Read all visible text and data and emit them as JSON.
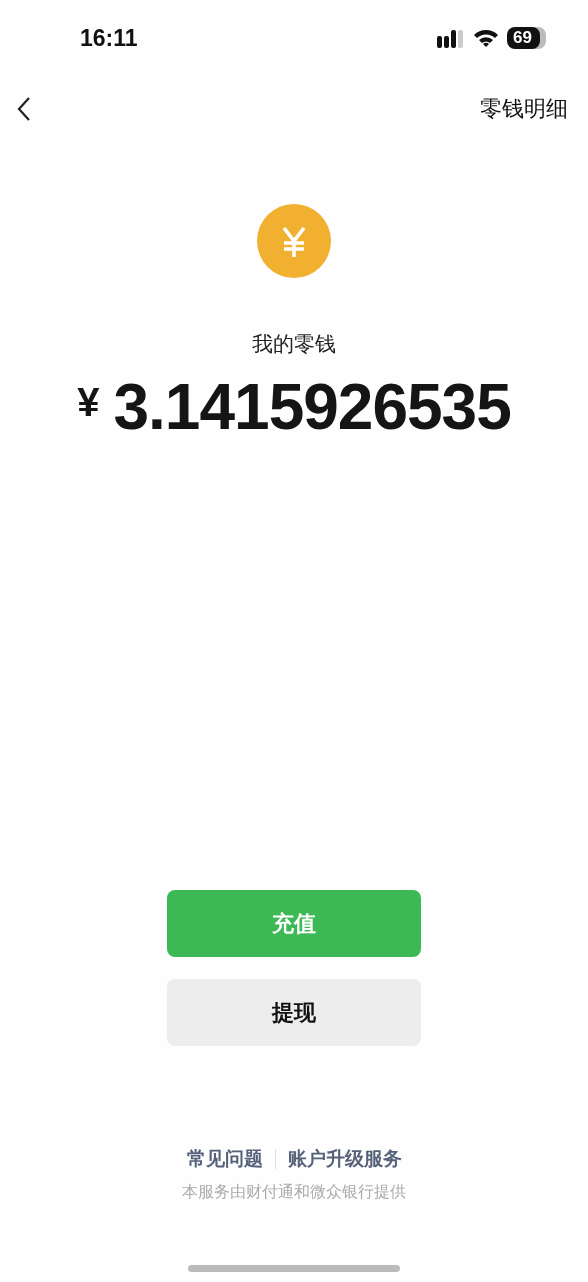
{
  "status_bar": {
    "time": "16:11",
    "battery": "69"
  },
  "nav": {
    "title": "零钱明细"
  },
  "balance": {
    "label": "我的零钱",
    "currency": "¥",
    "amount": "3.1415926535"
  },
  "buttons": [
    {
      "label": "充值",
      "kind": "primary"
    },
    {
      "label": "提现",
      "kind": "secondary"
    }
  ],
  "footer": {
    "links": [
      "常见问题",
      "账户升级服务"
    ],
    "note": "本服务由财付通和微众银行提供"
  }
}
